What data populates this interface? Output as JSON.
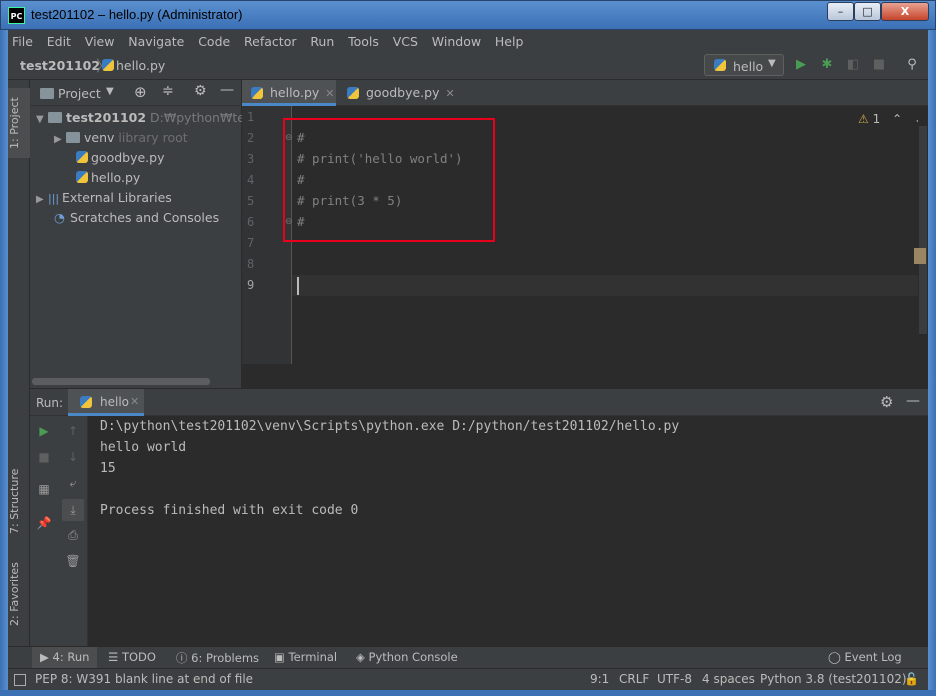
{
  "window": {
    "icon": "PC",
    "title": "test201102 – hello.py (Administrator)",
    "minimize": "–",
    "maximize": "□",
    "close": "X"
  },
  "menu": [
    "File",
    "Edit",
    "View",
    "Navigate",
    "Code",
    "Refactor",
    "Run",
    "Tools",
    "VCS",
    "Window",
    "Help"
  ],
  "navbar": {
    "project": "test201102",
    "file": "hello.py",
    "run_config": "hello"
  },
  "side_tabs": {
    "project": "1: Project",
    "structure": "7: Structure",
    "favorites": "2: Favorites"
  },
  "project_panel": {
    "title": "Project",
    "tree": [
      {
        "label": "test201102",
        "hint": "D:₩python₩test20",
        "kind": "root-folder"
      },
      {
        "label": "venv",
        "hint": "library root",
        "kind": "folder"
      },
      {
        "label": "goodbye.py",
        "hint": "",
        "kind": "py"
      },
      {
        "label": "hello.py",
        "hint": "",
        "kind": "py"
      },
      {
        "label": "External Libraries",
        "hint": "",
        "kind": "lib"
      },
      {
        "label": "Scratches and Consoles",
        "hint": "",
        "kind": "scratch"
      }
    ]
  },
  "editor": {
    "tabs": [
      {
        "label": "hello.py",
        "active": true
      },
      {
        "label": "goodbye.py",
        "active": false
      }
    ],
    "warnings": "1",
    "lines": [
      "#",
      "# print('hello world')",
      "#",
      "# print(3 * 5)",
      "#",
      "",
      "",
      "",
      ""
    ],
    "line_numbers": [
      "1",
      "2",
      "3",
      "4",
      "5",
      "6",
      "7",
      "8",
      "9"
    ]
  },
  "run_panel": {
    "label": "Run:",
    "tab": "hello",
    "output": [
      "D:\\python\\test201102\\venv\\Scripts\\python.exe D:/python/test201102/hello.py",
      "hello world",
      "15",
      "",
      "Process finished with exit code 0"
    ]
  },
  "bottom_tabs": [
    "4: Run",
    "TODO",
    "6: Problems",
    "Terminal",
    "Python Console",
    "Event Log"
  ],
  "status": {
    "message": "PEP 8: W391 blank line at end of file",
    "position": "9:1",
    "line_sep": "CRLF",
    "encoding": "UTF-8",
    "indent": "4 spaces",
    "interpreter": "Python 3.8 (test201102)"
  },
  "colors": {
    "accent": "#4a88c7",
    "run_green": "#499c54",
    "highlight_red": "#e8001c",
    "editor_bg": "#2b2b2b"
  }
}
